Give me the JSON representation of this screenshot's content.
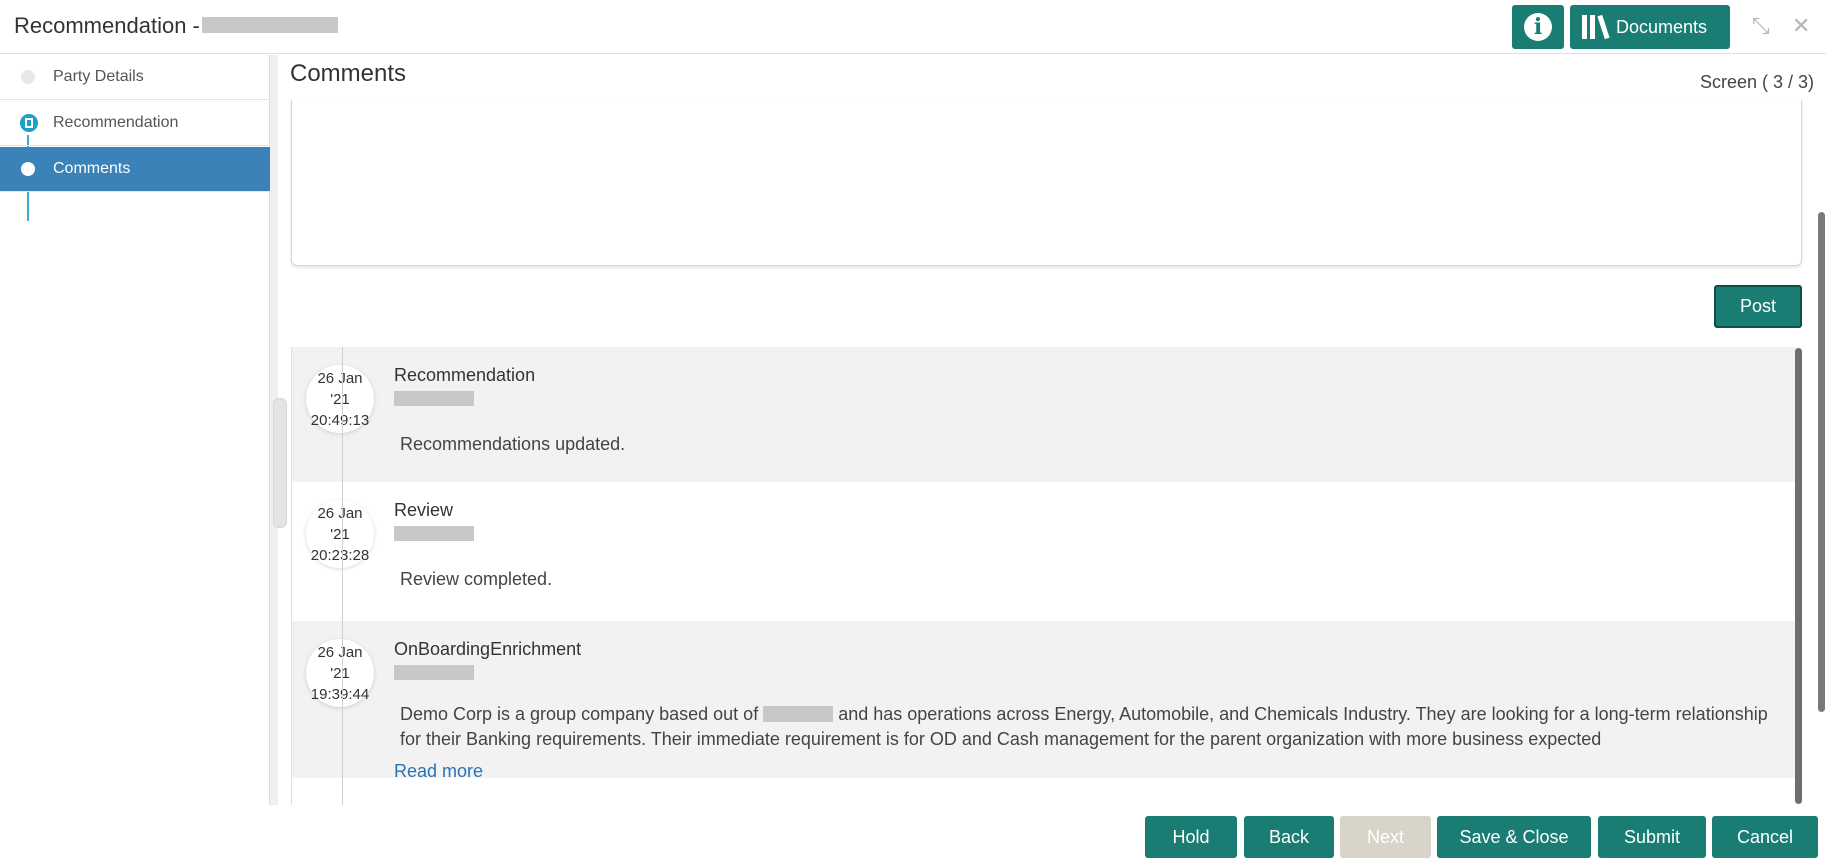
{
  "header": {
    "title": "Recommendation -",
    "info_icon": "info-icon",
    "documents_label": "Documents",
    "minimize_icon": "↙↗",
    "close_icon": "✕"
  },
  "sidebar": {
    "items": [
      {
        "label": "Party Details",
        "state": "done"
      },
      {
        "label": "Recommendation",
        "state": "document"
      },
      {
        "label": "Comments",
        "state": "active"
      }
    ]
  },
  "main": {
    "section_title": "Comments",
    "screen_counter": "Screen ( 3 / 3)",
    "post_label": "Post",
    "comments": [
      {
        "date": "26 Jan",
        "year": "'21",
        "time": "20:49:13",
        "stage": "Recommendation",
        "text": "Recommendations updated."
      },
      {
        "date": "26 Jan",
        "year": "'21",
        "time": "20:23:28",
        "stage": "Review",
        "text": "Review completed."
      },
      {
        "date": "26 Jan",
        "year": "'21",
        "time": "19:39:44",
        "stage": "OnBoardingEnrichment",
        "text_before": "Demo Corp is a group company based out of",
        "text_after": "and has operations across Energy, Automobile, and Chemicals Industry. They are looking for a long-term relationship for their Banking requirements. Their immediate requirement is for OD and Cash management for the parent organization with more business expected",
        "read_more": "Read more"
      }
    ]
  },
  "footer": {
    "hold": "Hold",
    "back": "Back",
    "next": "Next",
    "save_close": "Save & Close",
    "submit": "Submit",
    "cancel": "Cancel"
  },
  "colors": {
    "primary": "#1a7d74",
    "sidebar_active": "#3a82b8",
    "link": "#2a72b5",
    "disabled": "#d9d4ca"
  }
}
